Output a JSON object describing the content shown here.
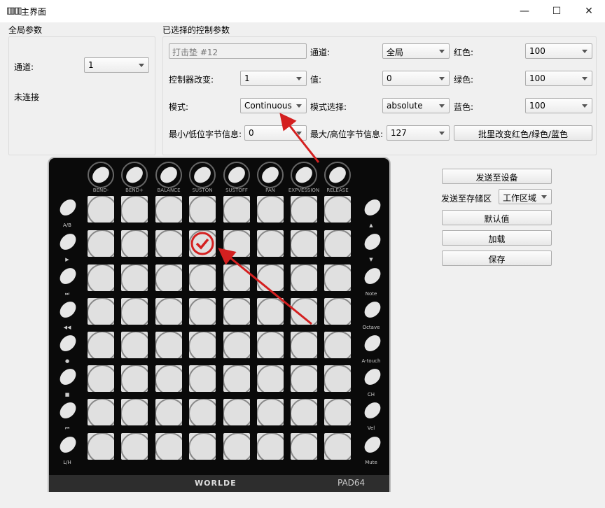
{
  "window": {
    "title": "主界面",
    "minimize": "—",
    "maximize": "☐",
    "close": "✕",
    "icon": "piano-icon"
  },
  "global": {
    "title": "全局参数",
    "channel_label": "通道:",
    "channel_value": "1",
    "status": "未连接"
  },
  "selected": {
    "title": "已选择的控制参数",
    "pad_name": "打击垫 #12",
    "channel_label": "通道:",
    "channel_value": "全局",
    "red_label": "红色:",
    "red_value": "100",
    "cc_label": "控制器改变:",
    "cc_value": "1",
    "value_label": "值:",
    "value_value": "0",
    "green_label": "绿色:",
    "green_value": "100",
    "mode_label": "模式:",
    "mode_value": "Continuous",
    "mode_select_label": "模式选择:",
    "mode_select_value": "absolute",
    "blue_label": "蓝色:",
    "blue_value": "100",
    "min_label": "最小/低位字节信息:",
    "min_value": "0",
    "max_label": "最大/高位字节信息:",
    "max_value": "127",
    "batch_button": "批里改变红色/绿色/蓝色"
  },
  "actions": {
    "send_device": "发送至设备",
    "send_storage_label": "发送至存储区",
    "storage_value": "工作区域",
    "defaults": "默认值",
    "load": "加载",
    "save": "保存"
  },
  "device": {
    "brand": "WORLDE",
    "model": "PAD64",
    "selected_pad": 12,
    "knobs": [
      "BEND-",
      "BEND+",
      "BALANCE",
      "SUSTON",
      "SUSTOFF",
      "PAN",
      "EXPVESSION",
      "RELEASE"
    ],
    "left_buttons": [
      "A/B",
      "▶",
      "⏭",
      "◀◀",
      "●",
      "■",
      "⏮",
      "L/H"
    ],
    "right_buttons": [
      "▲",
      "▼",
      "Note",
      "Octave",
      "A-touch",
      "CH",
      "Vel",
      "Mute"
    ]
  },
  "colors": {
    "annotation": "#d42020"
  }
}
